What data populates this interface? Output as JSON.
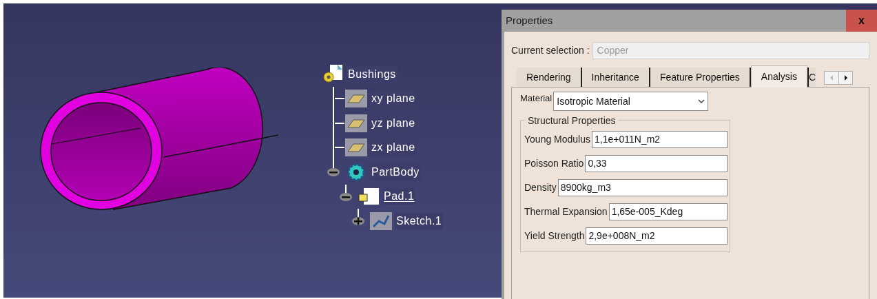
{
  "tree": {
    "label": "Bushings",
    "kind": "root",
    "children": [
      {
        "label": "xy plane",
        "kind": "plane"
      },
      {
        "label": "yz plane",
        "kind": "plane"
      },
      {
        "label": "zx plane",
        "kind": "plane"
      },
      {
        "label": "PartBody",
        "kind": "body",
        "expanded": true,
        "children": [
          {
            "label": "Pad.1",
            "kind": "pad",
            "in_work": true,
            "expanded": true,
            "children": [
              {
                "label": "Sketch.1",
                "kind": "sketch",
                "expanded": false
              }
            ]
          }
        ]
      }
    ]
  },
  "dialog": {
    "title": "Properties",
    "close": "x",
    "selection_label": "Current selection :",
    "selection_value": "Copper",
    "tabs": [
      {
        "label": "Rendering",
        "selected": false
      },
      {
        "label": "Inheritance",
        "selected": false
      },
      {
        "label": "Feature Properties",
        "selected": false
      },
      {
        "label": "Analysis",
        "selected": true
      },
      {
        "label": "C",
        "selected": false
      }
    ],
    "material_label": "Material",
    "material_value": "Isotropic Material",
    "group_title": "Structural Properties",
    "properties": [
      {
        "label": "Young Modulus",
        "value": "1,1e+011N_m2"
      },
      {
        "label": "Poisson Ratio",
        "value": "0,33"
      },
      {
        "label": "Density",
        "value": "8900kg_m3"
      },
      {
        "label": "Thermal Expansion",
        "value": "1,65e-005_Kdeg"
      },
      {
        "label": "Yield Strength",
        "value": "2,9e+008N_m2"
      }
    ]
  }
}
